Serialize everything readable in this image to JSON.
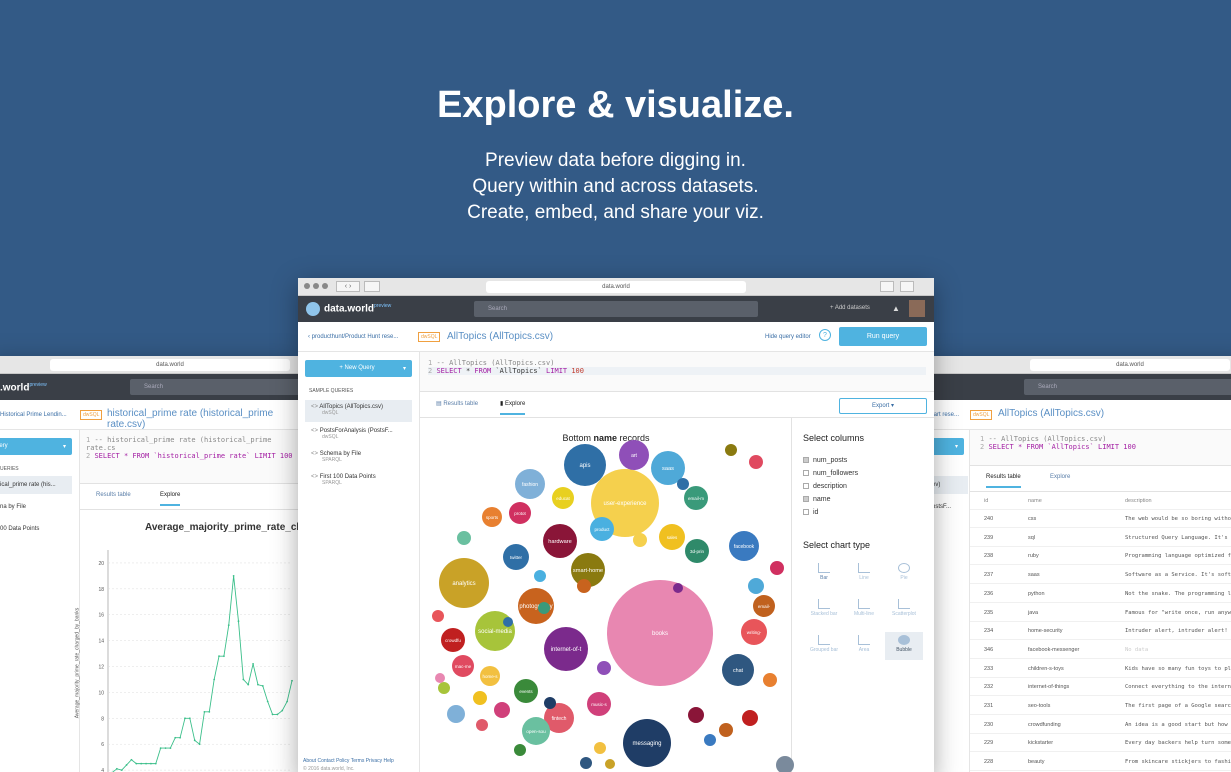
{
  "hero": {
    "title": "Explore & visualize.",
    "lines": [
      "Preview data before digging in.",
      "Query within and across datasets.",
      "Create, embed, and share your viz."
    ]
  },
  "center": {
    "url": "data.world",
    "logo": "data.world",
    "logo_sup": "preview",
    "search_placeholder": "Search",
    "add_datasets": "Add datasets",
    "breadcrumb": "producthunt/Product Hunt rese...",
    "lang_badge": "dwSQL",
    "file_title": "AllTopics (AllTopics.csv)",
    "hide_editor": "Hide query editor",
    "run_query": "Run query",
    "new_query": "+ New Query",
    "sample_queries_heading": "SAMPLE QUERIES",
    "queries": [
      {
        "title": "AllTopics (AllTopics.csv)",
        "lang": "dwSQL"
      },
      {
        "title": "PostsForAnalysis (PostsF...",
        "lang": "dwSQL"
      },
      {
        "title": "Schema by File",
        "lang": "SPARQL"
      },
      {
        "title": "First 100 Data Points",
        "lang": "SPARQL"
      }
    ],
    "code_line1": "-- AllTopics (AllTopics.csv)",
    "code_line2_kw1": "SELECT",
    "code_line2_mid": " * ",
    "code_line2_kw2": "FROM",
    "code_line2_tbl": " `AllTopics` ",
    "code_line2_kw3": "LIMIT",
    "code_line2_num": " 100",
    "tab_results": "Results table",
    "tab_explore": "Explore",
    "export": "Export ▾",
    "chart_title_pre": "Bottom ",
    "chart_title_bold": "name",
    "chart_title_post": " records",
    "select_columns": "Select columns",
    "columns": [
      {
        "label": "num_posts",
        "checked": true
      },
      {
        "label": "num_followers",
        "checked": false
      },
      {
        "label": "description",
        "checked": false
      },
      {
        "label": "name",
        "checked": true
      },
      {
        "label": "id",
        "checked": false
      }
    ],
    "select_chart_type": "Select chart type",
    "chart_types": [
      "Bar",
      "Line",
      "Pie",
      "Stacked bar",
      "Multi-line",
      "Scatterplot",
      "Grouped bar",
      "Area",
      "Bubble"
    ],
    "footer_links": "About  Contact  Policy  Terms  Privacy  Help",
    "footer_copy": "© 2016 data.world, Inc."
  },
  "left": {
    "url": "data.world",
    "logo": ".world",
    "logo_sup": "preview",
    "search_placeholder": "Search",
    "breadcrumb": "Historical Prime Lendin...",
    "lang_badge": "dwSQL",
    "file_title": "historical_prime rate (historical_prime rate.csv)",
    "query_btn": "uery",
    "queries_heading": "UERIES",
    "queries": [
      "ical_prime rate (his...",
      "na by File",
      "00 Data Points"
    ],
    "code_line1": "-- historical_prime rate (historical_prime rate.cs",
    "code_line2": "SELECT * FROM `historical_prime rate` LIMIT 100",
    "tab_results": "Results table",
    "tab_explore": "Explore",
    "chart_title": "Average_majority_prime_rate_charge",
    "ylabel": "Average_majority_prime_rate_charged_by_banks"
  },
  "right": {
    "url": "data.world",
    "search_placeholder": "Search",
    "breadcrumb": "tart rese...",
    "lang_badge": "dwSQL",
    "file_title": "AllTopics (AllTopics.csv)",
    "side_frag1": "ev)",
    "side_frag2": "ostsF...",
    "code_line1": "-- AllTopics (AllTopics.csv)",
    "code_line2": "SELECT * FROM `AllTopics` LIMIT 100",
    "tab_results": "Results table",
    "tab_explore": "Explore",
    "headers": [
      "id",
      "name",
      "description"
    ],
    "rows": [
      {
        "id": "240",
        "name": "css",
        "desc": "The web would be so boring withou"
      },
      {
        "id": "239",
        "name": "sql",
        "desc": "Structured Query Language. It's"
      },
      {
        "id": "238",
        "name": "ruby",
        "desc": "Programming language optimized f"
      },
      {
        "id": "237",
        "name": "saas",
        "desc": "Software as a Service. It's soft"
      },
      {
        "id": "236",
        "name": "python",
        "desc": "Not the snake. The programming l"
      },
      {
        "id": "235",
        "name": "java",
        "desc": "Famous for \"write once, run anyw"
      },
      {
        "id": "234",
        "name": "home-security",
        "desc": "Intruder alert, intruder alert!"
      },
      {
        "id": "346",
        "name": "facebook-messenger",
        "desc": "No data"
      },
      {
        "id": "233",
        "name": "children-s-toys",
        "desc": "Kids have so many fun toys to pl"
      },
      {
        "id": "232",
        "name": "internet-of-things",
        "desc": "Connect everything to the intern"
      },
      {
        "id": "231",
        "name": "seo-tools",
        "desc": "The first page of a Google searc"
      },
      {
        "id": "230",
        "name": "crowdfunding",
        "desc": "An idea is a good start but how"
      },
      {
        "id": "229",
        "name": "kickstarter",
        "desc": "Every day backers help turn some"
      },
      {
        "id": "228",
        "name": "beauty",
        "desc": "From skincare stickjers to fashio"
      }
    ]
  },
  "chart_data": [
    {
      "type": "line",
      "title": "Average_majority_prime_rate_charge",
      "ylabel": "Average_majority_prime_rate_charged_by_banks",
      "ylim": [
        2,
        21
      ],
      "yticks": [
        4,
        6,
        8,
        10,
        12,
        14,
        16,
        18,
        20
      ],
      "grid": true,
      "series": [
        {
          "values": [
            3.8,
            4.1,
            4,
            4.4,
            4.8,
            4.5,
            4.5,
            4.5,
            4.5,
            4.5,
            5.7,
            5.7,
            5.7,
            6.5,
            6.5,
            8,
            8,
            6.3,
            6,
            8.5,
            8.5,
            11,
            12.8,
            12.8,
            15.2,
            19,
            15.5,
            11,
            10.6,
            12.2,
            10.6,
            10.5,
            9.3,
            8.3,
            8.3,
            8.6,
            9.3,
            10.9
          ]
        }
      ]
    },
    {
      "type": "bubble",
      "title": "Bottom name records",
      "labels": [
        "books",
        "analytics",
        "messaging",
        "user-experience",
        "apis",
        "hardware",
        "social-media",
        "internet-of-thi",
        "chat",
        "photography",
        "smart-home",
        "fintech",
        "facebook",
        "fashion",
        "saas",
        "events",
        "art",
        "twitter",
        "writing-t",
        "email-m",
        "sales",
        "3d-prin",
        "email-ma",
        "crowdfun",
        "mac-men",
        "open-sour",
        "home-securi",
        "music-st",
        "education",
        "productivity",
        "sports",
        "prototy"
      ],
      "series_name": "num_posts",
      "color": "#e887b1"
    }
  ]
}
